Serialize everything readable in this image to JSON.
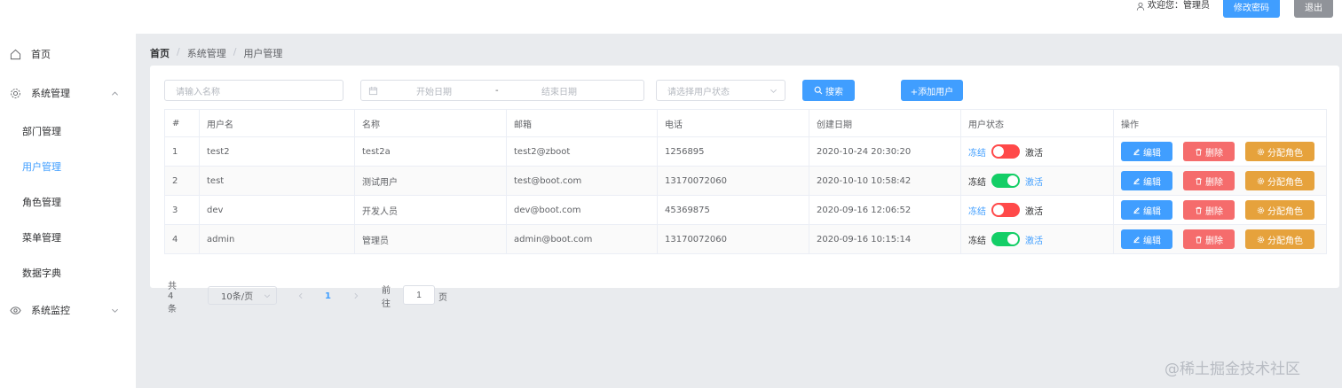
{
  "header": {
    "welcome": "欢迎您：管理员",
    "change_password": "修改密码",
    "logout": "退出"
  },
  "sidebar": {
    "home": "首页",
    "system_mgmt": "系统管理",
    "sub_items": [
      "部门管理",
      "用户管理",
      "角色管理",
      "菜单管理",
      "数据字典"
    ],
    "system_monitor": "系统监控"
  },
  "breadcrumb": [
    "首页",
    "系统管理",
    "用户管理"
  ],
  "search": {
    "name_placeholder": "请输入名称",
    "start_date_placeholder": "开始日期",
    "date_separator": "-",
    "end_date_placeholder": "结束日期",
    "status_placeholder": "请选择用户状态",
    "search_label": "搜索",
    "add_label": "+添加用户"
  },
  "table": {
    "columns": [
      "#",
      "用户名",
      "名称",
      "邮箱",
      "电话",
      "创建日期",
      "用户状态",
      "操作"
    ],
    "rows": [
      {
        "num": "1",
        "username": "test2",
        "name": "test2a",
        "email": "test2@zboot",
        "phone": "1256895",
        "created": "2020-10-24 20:30:20",
        "active": false
      },
      {
        "num": "2",
        "username": "test",
        "name": "测试用户",
        "email": "test@boot.com",
        "phone": "13170072060",
        "created": "2020-10-10 10:58:42",
        "active": true
      },
      {
        "num": "3",
        "username": "dev",
        "name": "开发人员",
        "email": "dev@boot.com",
        "phone": "45369875",
        "created": "2020-09-16 12:06:52",
        "active": false
      },
      {
        "num": "4",
        "username": "admin",
        "name": "管理员",
        "email": "admin@boot.com",
        "phone": "13170072060",
        "created": "2020-09-16 10:15:14",
        "active": true
      }
    ],
    "status_frozen": "冻结",
    "status_active": "激活",
    "op_edit": "编辑",
    "op_delete": "删除",
    "op_assign_role": "分配角色"
  },
  "pagination": {
    "total": "共 4 条",
    "page_size": "10条/页",
    "current_page": "1",
    "goto": "前往",
    "goto_value": "1",
    "page_suffix": "页"
  },
  "watermark": "@稀土掘金技术社区",
  "colors": {
    "primary": "#409eff",
    "danger": "#f56c6c",
    "warning": "#e6a23c",
    "switch_on": "#13ce66",
    "switch_off": "#ff4949"
  }
}
